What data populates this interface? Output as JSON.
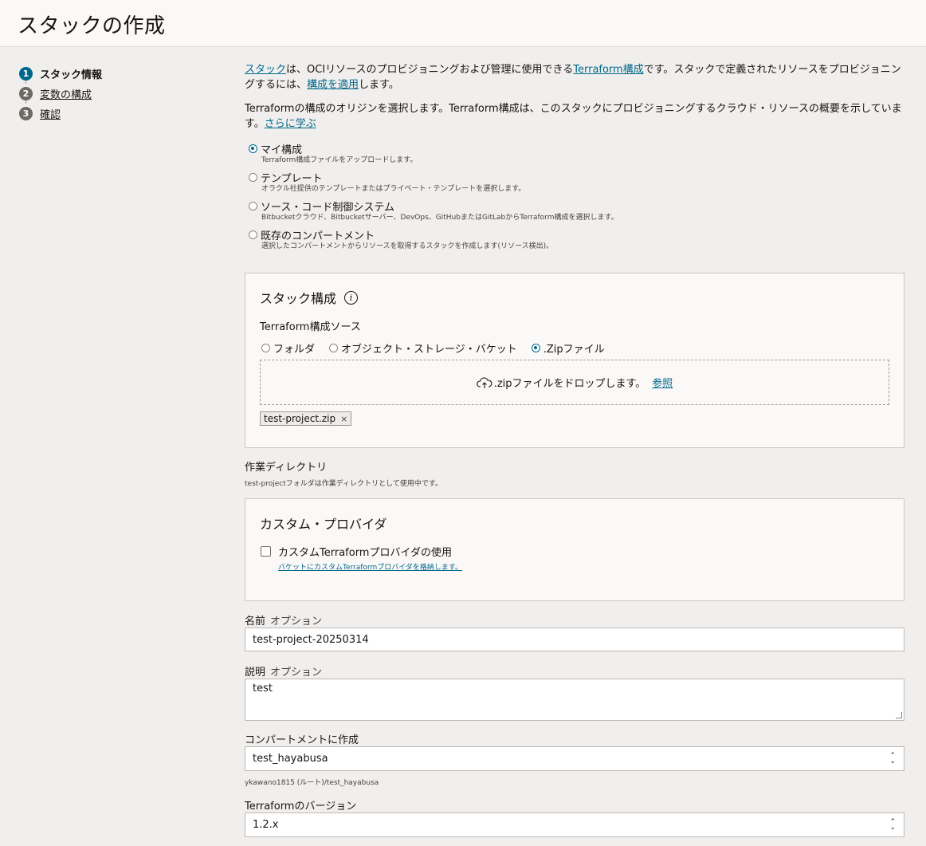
{
  "page": {
    "title": "スタックの作成"
  },
  "steps": [
    {
      "number": "1",
      "label": "スタック情報"
    },
    {
      "number": "2",
      "label": "変数の構成"
    },
    {
      "number": "3",
      "label": "確認"
    }
  ],
  "intro": {
    "link_stack": "スタック",
    "text1": "は、OCIリソースのプロビジョニングおよび管理に使用できる",
    "link_terraform": "Terraform構成",
    "text2": "です。スタックで定義されたリソースをプロビジョニングするには、",
    "link_apply": "構成を適用",
    "text3": "します。"
  },
  "origin": {
    "text": "Terraformの構成のオリジンを選択します。Terraform構成は、このスタックにプロビジョニングするクラウド・リソースの概要を示しています。",
    "link_learn": "さらに学ぶ"
  },
  "origin_options": [
    {
      "label": "マイ構成",
      "desc": "Terraform構成ファイルをアップロードします。",
      "selected": true
    },
    {
      "label": "テンプレート",
      "desc": "オラクル社提供のテンプレートまたはプライベート・テンプレートを選択します。",
      "selected": false
    },
    {
      "label": "ソース・コード制御システム",
      "desc": "Bitbucketクラウド、Bitbucketサーバー、DevOps、GitHubまたはGitLabからTerraform構成を選択します。",
      "selected": false
    },
    {
      "label": "既存のコンパートメント",
      "desc": "選択したコンパートメントからリソースを取得するスタックを作成します(リソース検出)。",
      "selected": false
    }
  ],
  "stack_config": {
    "title": "スタック構成",
    "info_icon": "i",
    "source_label": "Terraform構成ソース",
    "sources": [
      {
        "label": "フォルダ",
        "selected": false
      },
      {
        "label": "オブジェクト・ストレージ・バケット",
        "selected": false
      },
      {
        "label": ".Zipファイル",
        "selected": true
      }
    ],
    "drop_text": ".zipファイルをドロップします。",
    "browse_link": "参照",
    "file_chip": "test-project.zip",
    "chip_remove": "×"
  },
  "working_dir": {
    "label": "作業ディレクトリ",
    "note": "test-projectフォルダは作業ディレクトリとして使用中です。"
  },
  "custom_provider": {
    "title": "カスタム・プロバイダ",
    "checkbox_label": "カスタムTerraformプロバイダの使用",
    "checked": false,
    "link": "バケットにカスタムTerraformプロバイダを格納します。"
  },
  "form": {
    "name_label": "名前",
    "name_optional": "オプション",
    "name_value": "test-project-20250314",
    "desc_label": "説明",
    "desc_optional": "オプション",
    "desc_value": "test",
    "compartment_label": "コンパートメントに作成",
    "compartment_value": "test_hayabusa",
    "compartment_path": "ykawano1815 (ルート)/test_hayabusa",
    "tf_version_label": "Terraformのバージョン",
    "tf_version_value": "1.2.x"
  },
  "colors": {
    "accent": "#00688c",
    "background": "#f1efed",
    "panel": "#fbf9f8"
  }
}
